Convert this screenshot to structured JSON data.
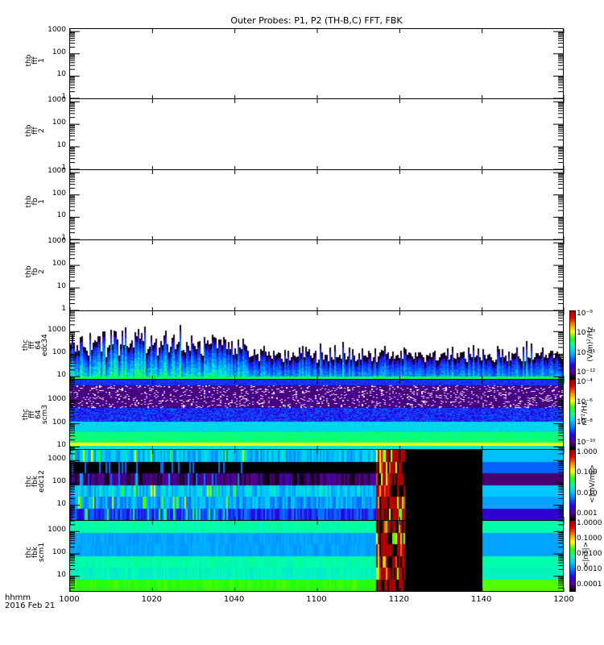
{
  "chart_data": {
    "type": "heatmap",
    "title": "Outer Probes: P1, P2 (TH-B,C) FFT, FBK",
    "xlabel": "hhmm",
    "date": "2016 Feb 21",
    "xlim": [
      "1000",
      "1200"
    ],
    "x_ticks": [
      "1000",
      "1020",
      "1040",
      "1100",
      "1120",
      "1140",
      "1200"
    ],
    "panels": [
      {
        "label": [
          "thb",
          "fff",
          "1"
        ],
        "ylim": [
          1,
          1300
        ],
        "y_ticks": [
          "1",
          "10",
          "100",
          "1000"
        ],
        "kind": "empty"
      },
      {
        "label": [
          "thb",
          "fff",
          "2"
        ],
        "ylim": [
          1,
          1300
        ],
        "y_ticks": [
          "1",
          "10",
          "100",
          "1000"
        ],
        "kind": "empty"
      },
      {
        "label": [
          "thb",
          "fb",
          "1"
        ],
        "ylim": [
          1,
          1300
        ],
        "y_ticks": [
          "1",
          "10",
          "100",
          "1000"
        ],
        "kind": "empty"
      },
      {
        "label": [
          "thb",
          "fb",
          "2"
        ],
        "ylim": [
          1,
          1300
        ],
        "y_ticks": [
          "1",
          "10",
          "100",
          "1000"
        ],
        "kind": "empty"
      },
      {
        "label": [
          "thc",
          "fff",
          "64",
          "edc34"
        ],
        "ylim": [
          8,
          8000
        ],
        "y_ticks": [
          "10",
          "100",
          "1000"
        ],
        "kind": "fft_e",
        "colorbar": {
          "ticks": [
            "10⁻⁹",
            "10⁻¹⁰",
            "10⁻¹¹",
            "10⁻¹²"
          ],
          "unit": "(V/m)²/Hz"
        }
      },
      {
        "label": [
          "thc",
          "fff",
          "64",
          "scm3"
        ],
        "ylim": [
          8,
          8000
        ],
        "y_ticks": [
          "10",
          "100",
          "1000"
        ],
        "kind": "fft_b",
        "colorbar": {
          "ticks": [
            "10⁻⁴",
            "10⁻⁶",
            "10⁻⁸",
            "10⁻¹⁰"
          ],
          "unit": "nT²/Hz"
        }
      },
      {
        "label": [
          "thc",
          "fbk",
          "edc12"
        ],
        "ylim": [
          2.2,
          3000
        ],
        "y_ticks": [
          "10",
          "100",
          "1000"
        ],
        "kind": "fbk_e",
        "colorbar": {
          "ticks": [
            "1.000",
            "0.100",
            "0.010",
            "0.001"
          ],
          "unit": "<|mV/m|>"
        }
      },
      {
        "label": [
          "thc",
          "fbk",
          "scm1"
        ],
        "ylim": [
          2.2,
          3000
        ],
        "y_ticks": [
          "10",
          "100",
          "1000"
        ],
        "kind": "fbk_b",
        "colorbar": {
          "ticks": [
            "1.0000",
            "0.1000",
            "0.0100",
            "0.0010",
            "0.0001"
          ],
          "unit": "<|nT|>"
        }
      }
    ],
    "events": {
      "burst_start_min": 74,
      "burst_end_min": 81,
      "nodata_end_min": 100
    }
  }
}
